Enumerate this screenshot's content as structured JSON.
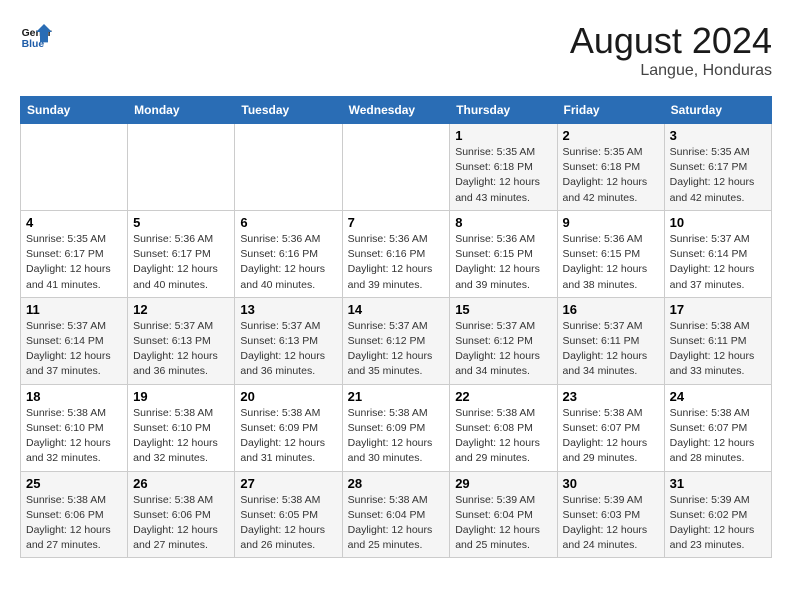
{
  "logo": {
    "general": "General",
    "blue": "Blue"
  },
  "title": "August 2024",
  "subtitle": "Langue, Honduras",
  "days_of_week": [
    "Sunday",
    "Monday",
    "Tuesday",
    "Wednesday",
    "Thursday",
    "Friday",
    "Saturday"
  ],
  "weeks": [
    [
      {
        "day": "",
        "info": ""
      },
      {
        "day": "",
        "info": ""
      },
      {
        "day": "",
        "info": ""
      },
      {
        "day": "",
        "info": ""
      },
      {
        "day": "1",
        "info": "Sunrise: 5:35 AM\nSunset: 6:18 PM\nDaylight: 12 hours\nand 43 minutes."
      },
      {
        "day": "2",
        "info": "Sunrise: 5:35 AM\nSunset: 6:18 PM\nDaylight: 12 hours\nand 42 minutes."
      },
      {
        "day": "3",
        "info": "Sunrise: 5:35 AM\nSunset: 6:17 PM\nDaylight: 12 hours\nand 42 minutes."
      }
    ],
    [
      {
        "day": "4",
        "info": "Sunrise: 5:35 AM\nSunset: 6:17 PM\nDaylight: 12 hours\nand 41 minutes."
      },
      {
        "day": "5",
        "info": "Sunrise: 5:36 AM\nSunset: 6:17 PM\nDaylight: 12 hours\nand 40 minutes."
      },
      {
        "day": "6",
        "info": "Sunrise: 5:36 AM\nSunset: 6:16 PM\nDaylight: 12 hours\nand 40 minutes."
      },
      {
        "day": "7",
        "info": "Sunrise: 5:36 AM\nSunset: 6:16 PM\nDaylight: 12 hours\nand 39 minutes."
      },
      {
        "day": "8",
        "info": "Sunrise: 5:36 AM\nSunset: 6:15 PM\nDaylight: 12 hours\nand 39 minutes."
      },
      {
        "day": "9",
        "info": "Sunrise: 5:36 AM\nSunset: 6:15 PM\nDaylight: 12 hours\nand 38 minutes."
      },
      {
        "day": "10",
        "info": "Sunrise: 5:37 AM\nSunset: 6:14 PM\nDaylight: 12 hours\nand 37 minutes."
      }
    ],
    [
      {
        "day": "11",
        "info": "Sunrise: 5:37 AM\nSunset: 6:14 PM\nDaylight: 12 hours\nand 37 minutes."
      },
      {
        "day": "12",
        "info": "Sunrise: 5:37 AM\nSunset: 6:13 PM\nDaylight: 12 hours\nand 36 minutes."
      },
      {
        "day": "13",
        "info": "Sunrise: 5:37 AM\nSunset: 6:13 PM\nDaylight: 12 hours\nand 36 minutes."
      },
      {
        "day": "14",
        "info": "Sunrise: 5:37 AM\nSunset: 6:12 PM\nDaylight: 12 hours\nand 35 minutes."
      },
      {
        "day": "15",
        "info": "Sunrise: 5:37 AM\nSunset: 6:12 PM\nDaylight: 12 hours\nand 34 minutes."
      },
      {
        "day": "16",
        "info": "Sunrise: 5:37 AM\nSunset: 6:11 PM\nDaylight: 12 hours\nand 34 minutes."
      },
      {
        "day": "17",
        "info": "Sunrise: 5:38 AM\nSunset: 6:11 PM\nDaylight: 12 hours\nand 33 minutes."
      }
    ],
    [
      {
        "day": "18",
        "info": "Sunrise: 5:38 AM\nSunset: 6:10 PM\nDaylight: 12 hours\nand 32 minutes."
      },
      {
        "day": "19",
        "info": "Sunrise: 5:38 AM\nSunset: 6:10 PM\nDaylight: 12 hours\nand 32 minutes."
      },
      {
        "day": "20",
        "info": "Sunrise: 5:38 AM\nSunset: 6:09 PM\nDaylight: 12 hours\nand 31 minutes."
      },
      {
        "day": "21",
        "info": "Sunrise: 5:38 AM\nSunset: 6:09 PM\nDaylight: 12 hours\nand 30 minutes."
      },
      {
        "day": "22",
        "info": "Sunrise: 5:38 AM\nSunset: 6:08 PM\nDaylight: 12 hours\nand 29 minutes."
      },
      {
        "day": "23",
        "info": "Sunrise: 5:38 AM\nSunset: 6:07 PM\nDaylight: 12 hours\nand 29 minutes."
      },
      {
        "day": "24",
        "info": "Sunrise: 5:38 AM\nSunset: 6:07 PM\nDaylight: 12 hours\nand 28 minutes."
      }
    ],
    [
      {
        "day": "25",
        "info": "Sunrise: 5:38 AM\nSunset: 6:06 PM\nDaylight: 12 hours\nand 27 minutes."
      },
      {
        "day": "26",
        "info": "Sunrise: 5:38 AM\nSunset: 6:06 PM\nDaylight: 12 hours\nand 27 minutes."
      },
      {
        "day": "27",
        "info": "Sunrise: 5:38 AM\nSunset: 6:05 PM\nDaylight: 12 hours\nand 26 minutes."
      },
      {
        "day": "28",
        "info": "Sunrise: 5:38 AM\nSunset: 6:04 PM\nDaylight: 12 hours\nand 25 minutes."
      },
      {
        "day": "29",
        "info": "Sunrise: 5:39 AM\nSunset: 6:04 PM\nDaylight: 12 hours\nand 25 minutes."
      },
      {
        "day": "30",
        "info": "Sunrise: 5:39 AM\nSunset: 6:03 PM\nDaylight: 12 hours\nand 24 minutes."
      },
      {
        "day": "31",
        "info": "Sunrise: 5:39 AM\nSunset: 6:02 PM\nDaylight: 12 hours\nand 23 minutes."
      }
    ]
  ]
}
